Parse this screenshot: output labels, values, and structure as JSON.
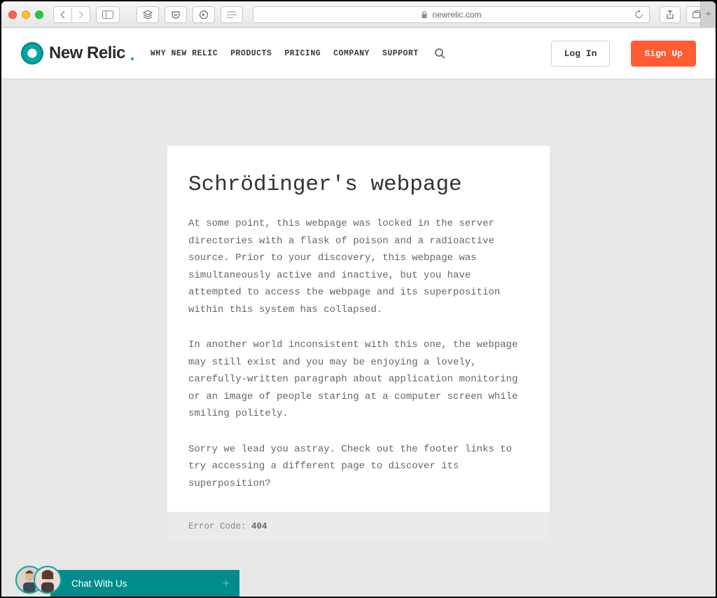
{
  "browser": {
    "url_host": "newrelic.com"
  },
  "header": {
    "brand": "New Relic",
    "nav": [
      "WHY NEW RELIC",
      "PRODUCTS",
      "PRICING",
      "COMPANY",
      "SUPPORT"
    ],
    "login": "Log In",
    "signup": "Sign Up"
  },
  "error": {
    "title": "Schrödinger's webpage",
    "p1": "At some point, this webpage was locked in the server directories with a flask of poison and a radioactive source. Prior to your discovery, this webpage was simultaneously active and inactive, but you have attempted to access the webpage and its superposition within this system has collapsed.",
    "p2": "In another world inconsistent with this one, the webpage may still exist and you may be enjoying a lovely, carefully-written paragraph about application monitoring or an image of people staring at a computer screen while smiling politely.",
    "p3": "Sorry we lead you astray. Check out the footer links to try accessing a different page to discover its superposition?",
    "code_label": "Error Code: ",
    "code_value": "404"
  },
  "chat": {
    "label": "Chat With Us"
  }
}
